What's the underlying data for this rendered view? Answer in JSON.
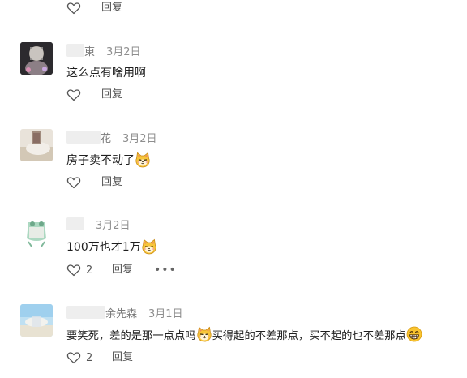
{
  "top_actions": {
    "reply_label": "回复"
  },
  "comments": [
    {
      "name_suffix": "東",
      "date": "3月2日",
      "text": "这么点有啥用啊",
      "like_count": "",
      "reply_label": "回复"
    },
    {
      "name_suffix": "花",
      "date": "3月2日",
      "text": "房子卖不动了",
      "like_count": "",
      "reply_label": "回复"
    },
    {
      "name_suffix": "",
      "date": "3月2日",
      "text": "100万也才1万",
      "like_count": "2",
      "reply_label": "回复",
      "more_label": "•••"
    },
    {
      "name_suffix": "余先森",
      "date": "3月1日",
      "text_part1": "要笑死，差的是那一点点吗",
      "text_part2": "买得起的不差那点，买不起的也不差那点",
      "like_count": "2",
      "reply_label": "回复"
    }
  ],
  "icons": {
    "like": "heart-outline-icon",
    "emoji_cat": "cat-emoji-icon",
    "emoji_grin": "grin-emoji-icon"
  }
}
